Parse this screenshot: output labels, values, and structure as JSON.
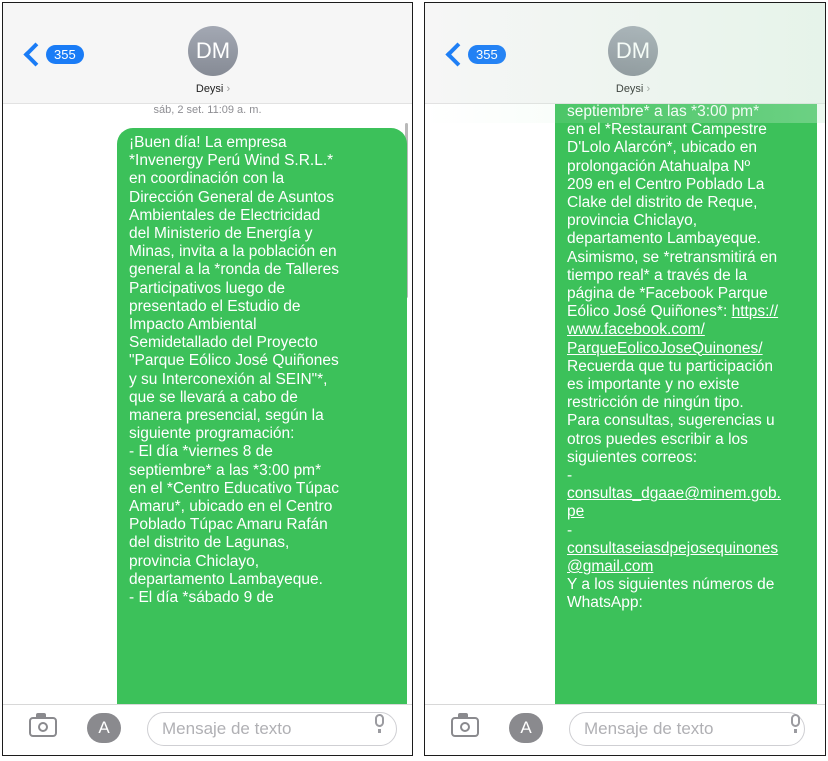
{
  "colors": {
    "bubble": "#3cc15a",
    "accent": "#1a7cf6",
    "header": "#f6f6f6"
  },
  "header": {
    "unread_count": "355",
    "avatar_initials": "DM",
    "contact_name": "Deysi",
    "chevron": "›"
  },
  "conversation": {
    "timestamp": "sáb, 2 set. 11:09 a. m."
  },
  "message_part1_lines": [
    "¡Buen día! La empresa",
    "*Invenergy Perú Wind S.R.L.*",
    "en coordinación con la",
    "Dirección General de Asuntos",
    "Ambientales de Electricidad",
    "del Ministerio de Energía y",
    "Minas, invita a la población en",
    "general a la *ronda de Talleres",
    "Participativos luego de",
    "presentado el Estudio de",
    "Impacto Ambiental",
    "Semidetallado del Proyecto",
    "\"Parque Eólico José Quiñones",
    "y su Interconexión al SEIN\"*,",
    "que se llevará a cabo de",
    "manera presencial, según la",
    "siguiente programación:",
    "-    El día *viernes 8 de",
    "septiembre* a las *3:00 pm*",
    "en el *Centro Educativo Túpac",
    "Amaru*, ubicado en el Centro",
    "Poblado Túpac Amaru Rafán",
    "del distrito de Lagunas,",
    "provincia Chiclayo,",
    "departamento Lambayeque.",
    "-    El día *sábado 9 de"
  ],
  "message_part2_lines": [
    "septiembre* a las *3:00 pm*",
    "en el *Restaurant Campestre",
    "D'Lolo Alarcón*, ubicado en",
    "prolongación Atahualpa Nº",
    "209 en el Centro Poblado La",
    "Clake del distrito de Reque,",
    "provincia Chiclayo,",
    "departamento Lambayeque.",
    "Asimismo, se *retransmitirá en",
    "tiempo real* a través de la",
    "página de *Facebook Parque",
    "Eólico José Quiñones*:"
  ],
  "message_part2_link_inline": "https://",
  "message_part2_link_lines": [
    "www.facebook.com/",
    "ParqueEolicoJoseQuinones/"
  ],
  "message_part3_lines": [
    "Recuerda que tu participación",
    "es importante y no existe",
    "restricción de ningún tipo.",
    "Para consultas, sugerencias u",
    "otros puedes escribir a los",
    "siguientes correos:",
    "-"
  ],
  "email1_lines": [
    "consultas_dgaae@minem.gob.",
    "pe"
  ],
  "dash2": "-",
  "email2_lines": [
    "consultaseiasdpejosequinones",
    "@gmail.com"
  ],
  "message_part4_lines": [
    "Y a los siguientes números de",
    "WhatsApp:"
  ],
  "composer": {
    "placeholder": "Mensaje de texto",
    "appstore_glyph": "A"
  }
}
